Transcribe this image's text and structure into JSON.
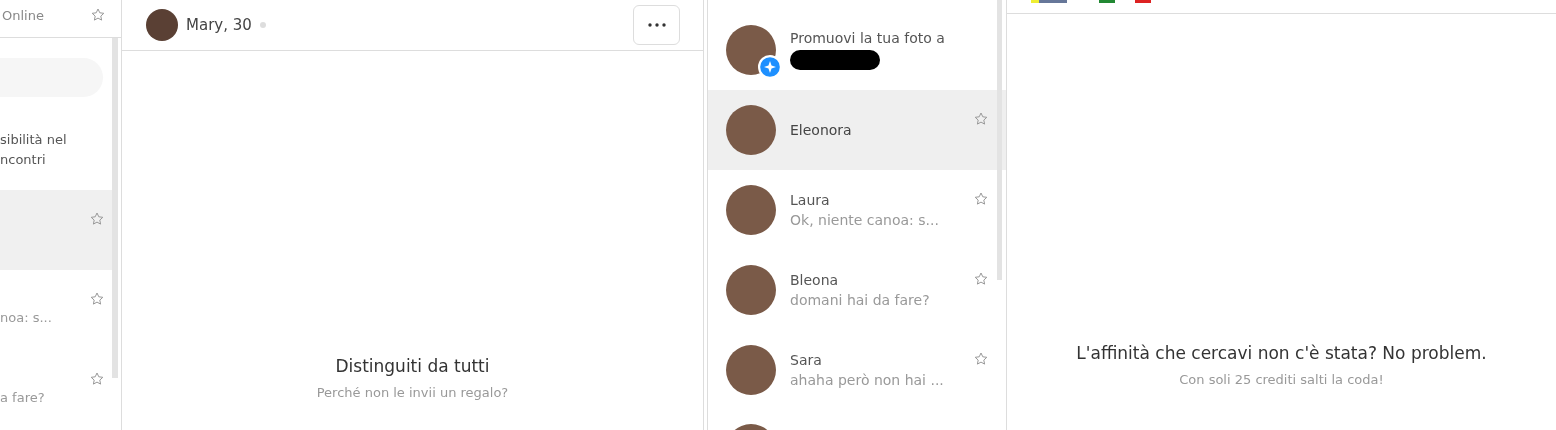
{
  "left_list": {
    "status": "Online",
    "notice_lines": [
      "sibilità nel",
      "ncontri"
    ],
    "rows": [
      {
        "preview": "",
        "selected": true,
        "starred": false
      },
      {
        "preview": "noa: s...",
        "selected": false,
        "starred": false
      },
      {
        "preview": "a fare?",
        "selected": false,
        "starred": false
      }
    ]
  },
  "chat": {
    "name": "Mary, 30",
    "online": false,
    "title": "Distinguiti da tutti",
    "subtitle": "Perché non le invii un regalo?"
  },
  "conversations": {
    "promo": {
      "text": "Promuovi la tua foto a"
    },
    "rows": [
      {
        "name": "Eleonora",
        "preview": "",
        "selected": true,
        "starred": false
      },
      {
        "name": "Laura",
        "preview": "Ok, niente canoa: s...",
        "selected": false,
        "starred": false
      },
      {
        "name": "Bleona",
        "preview": "domani hai da fare?",
        "selected": false,
        "starred": false
      },
      {
        "name": "Sara",
        "preview": "ahaha però non hai ...",
        "selected": false,
        "starred": false
      }
    ]
  },
  "right": {
    "title": "L'affinità che cercavi non c'è stata? No problem.",
    "subtitle": "Con soli 25 crediti salti la coda!"
  }
}
